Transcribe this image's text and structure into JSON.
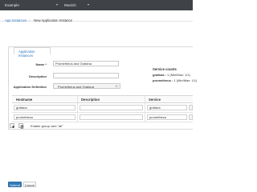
{
  "topbar": {
    "brand": "Example",
    "project": "Munich"
  },
  "breadcrumb": {
    "link": "App Instances",
    "separator": "›",
    "current": "New Application Instance"
  },
  "tab": {
    "label": "Application Instances"
  },
  "form": {
    "name_label": "Name *",
    "name_value": "Prometheus and Grafana",
    "description_label": "Description",
    "description_value": "",
    "definition_label": "Application Definition",
    "definition_value": "Prometheus and Grafana"
  },
  "service_counts": {
    "title": "Service counts",
    "items": [
      {
        "name": "grafana :",
        "value": "1 (Min/Max: 1/1)"
      },
      {
        "name": "prometheus :",
        "value": "1 (Min/Max: 1/1)"
      }
    ]
  },
  "table": {
    "headers": [
      "Hostname",
      "Description",
      "Service"
    ],
    "rows": [
      {
        "hostname": "grafana",
        "description": "",
        "service": "grafana"
      },
      {
        "hostname": "prometheus",
        "description": "",
        "service": "prometheus"
      }
    ]
  },
  "hint": "Enable group vars \"all\"",
  "actions": {
    "submit": "Submit",
    "cancel": "Cancel"
  },
  "colors": {
    "topbar": "#3f4348",
    "link": "#2b78c2",
    "primary": "#337ab7"
  }
}
